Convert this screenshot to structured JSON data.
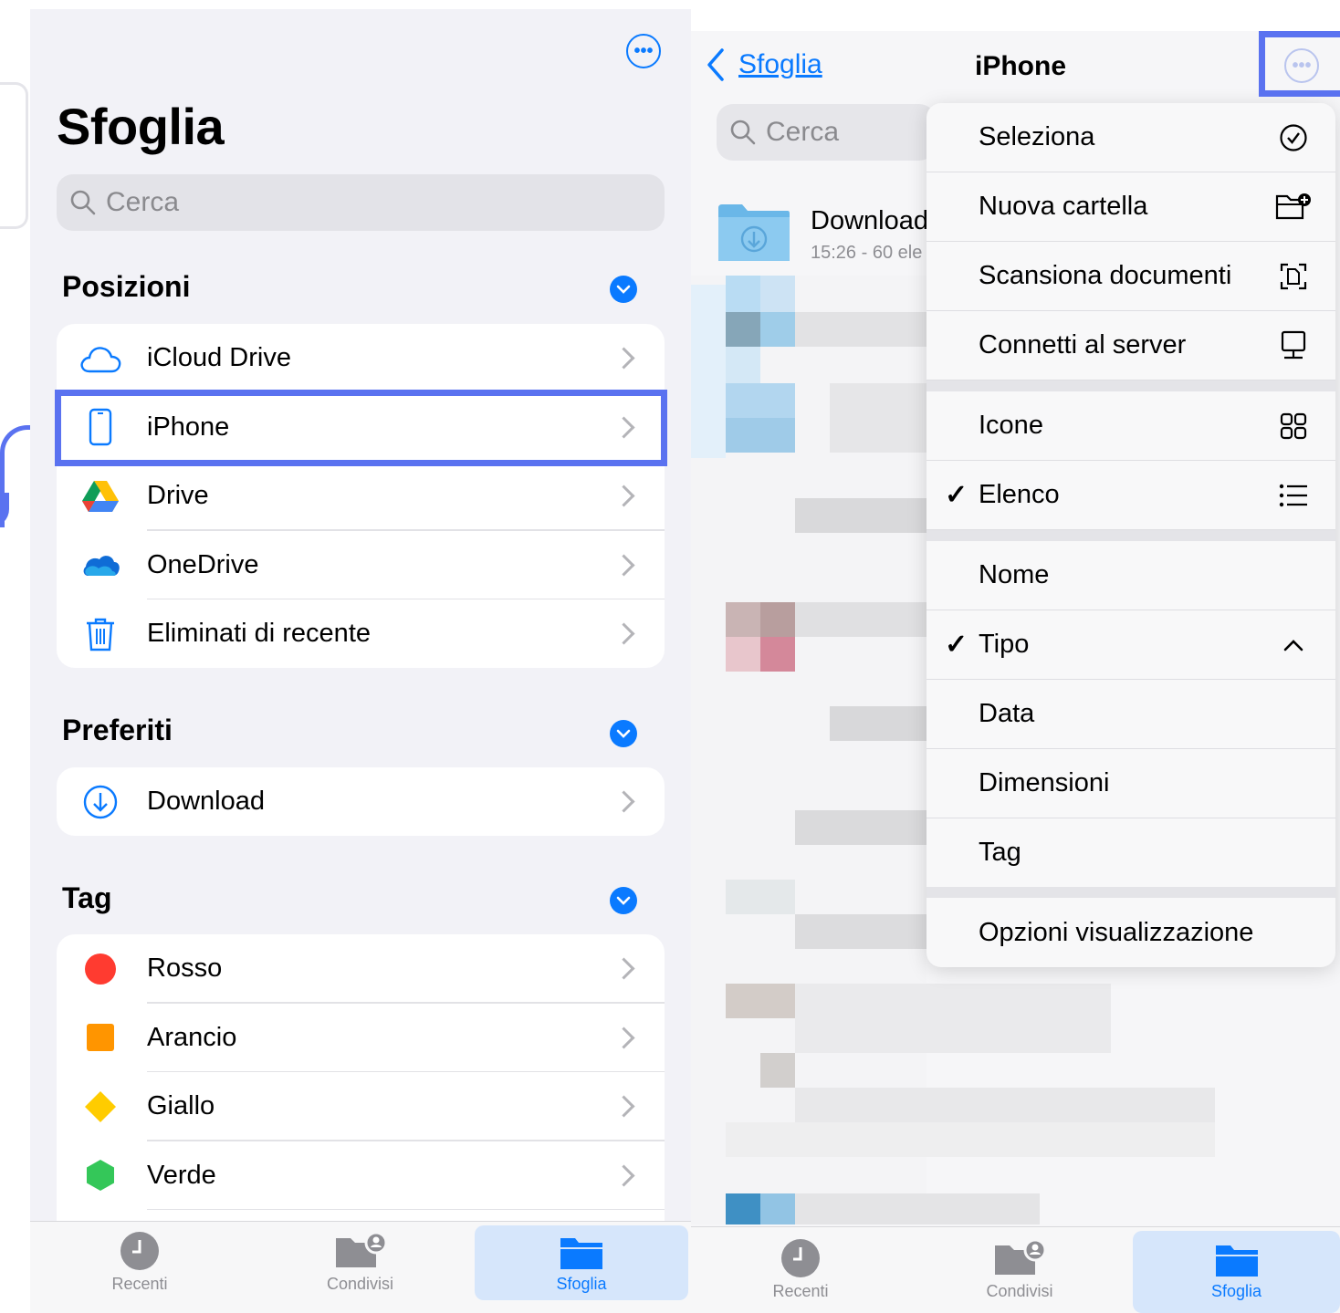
{
  "left": {
    "title": "Sfoglia",
    "search_placeholder": "Cerca",
    "sections": {
      "posizioni": "Posizioni",
      "preferiti": "Preferiti",
      "tag": "Tag"
    },
    "locations": [
      {
        "label": "iCloud Drive",
        "icon": "cloud-icon"
      },
      {
        "label": "iPhone",
        "icon": "phone-icon"
      },
      {
        "label": "Drive",
        "icon": "google-drive-icon"
      },
      {
        "label": "OneDrive",
        "icon": "onedrive-icon"
      },
      {
        "label": "Eliminati di recente",
        "icon": "trash-icon"
      }
    ],
    "favorites": [
      {
        "label": "Download",
        "icon": "download-icon"
      }
    ],
    "tags": [
      {
        "label": "Rosso",
        "color": "#ff3b30"
      },
      {
        "label": "Arancio",
        "color": "#ff9500"
      },
      {
        "label": "Giallo",
        "color": "#ffcc00"
      },
      {
        "label": "Verde",
        "color": "#34c759"
      }
    ]
  },
  "right": {
    "back_label": "Sfoglia",
    "title": "iPhone",
    "search_placeholder": "Cerca",
    "folder": {
      "name": "Download",
      "meta": "15:26 - 60 ele"
    },
    "menu": {
      "group1": [
        {
          "label": "Seleziona",
          "icon": "checkmark-circle-icon"
        },
        {
          "label": "Nuova cartella",
          "icon": "new-folder-icon"
        },
        {
          "label": "Scansiona documenti",
          "icon": "scan-document-icon"
        },
        {
          "label": "Connetti al server",
          "icon": "server-icon"
        }
      ],
      "group2": [
        {
          "label": "Icone",
          "icon": "grid-icon",
          "checked": false
        },
        {
          "label": "Elenco",
          "icon": "list-icon",
          "checked": true
        }
      ],
      "group3": [
        {
          "label": "Nome",
          "checked": false
        },
        {
          "label": "Tipo",
          "checked": true,
          "icon": "chevron-up-icon"
        },
        {
          "label": "Data",
          "checked": false
        },
        {
          "label": "Dimensioni",
          "checked": false
        },
        {
          "label": "Tag",
          "checked": false
        }
      ],
      "group4": [
        {
          "label": "Opzioni visualizzazione"
        }
      ],
      "check_glyph": "✓"
    }
  },
  "tabbar": {
    "tabs": [
      {
        "label": "Recenti",
        "icon": "clock-icon"
      },
      {
        "label": "Condivisi",
        "icon": "shared-folder-icon"
      },
      {
        "label": "Sfoglia",
        "icon": "folder-icon",
        "active": true
      }
    ]
  },
  "colors": {
    "accent": "#0a7aff",
    "highlight": "#5a72f0"
  }
}
